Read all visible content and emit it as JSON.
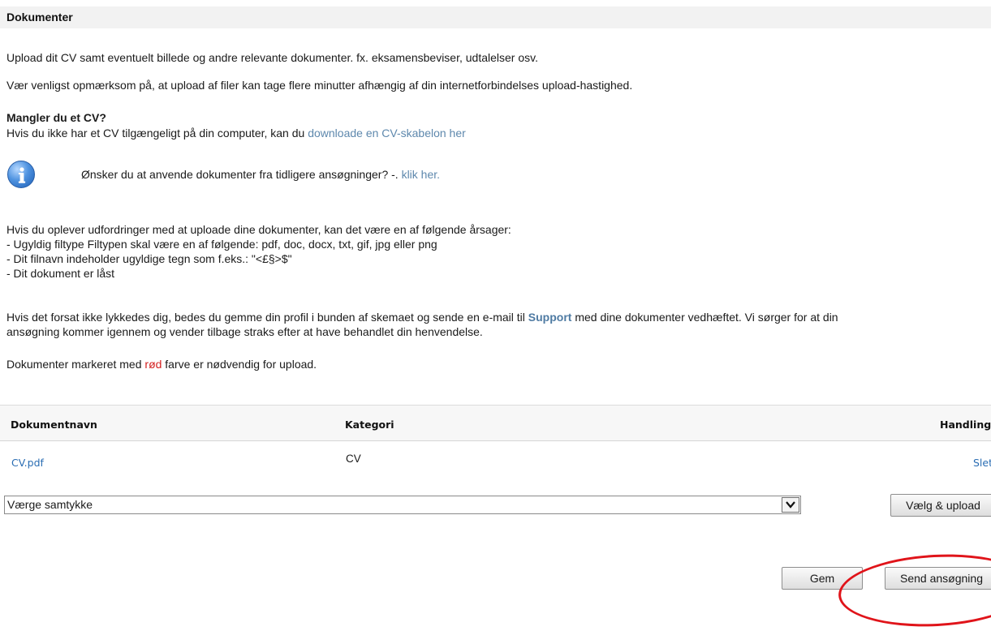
{
  "header": {
    "title": "Dokumenter"
  },
  "intro": {
    "line1": "Upload dit CV samt eventuelt billede og andre relevante dokumenter. fx. eksamensbeviser, udtalelser osv.",
    "line2": "Vær venligst opmærksom på, at upload af filer kan tage flere minutter afhængig af din internetforbindelses upload-hastighed."
  },
  "cv_missing": {
    "heading": "Mangler du et CV?",
    "text": "Hvis du ikke har et CV tilgængeligt på din computer, kan du ",
    "link": "downloade en CV-skabelon her"
  },
  "info": {
    "text": "Ønsker du at anvende dokumenter fra tidligere ansøgninger? -. ",
    "link": "klik her."
  },
  "problems": {
    "intro": "Hvis du oplever udfordringer med at uploade dine dokumenter, kan det være en af følgende årsager:",
    "items": [
      "- Ugyldig filtype Filtypen skal være en af følgende: pdf, doc, docx, txt, gif, jpg eller png",
      "- Dit filnavn indeholder ugyldige tegn som f.eks.: \"<£§>$\"",
      "- Dit dokument er låst"
    ]
  },
  "support": {
    "before": "Hvis det forsat ikke lykkedes dig, bedes du gemme din profil i bunden af skemaet og sende en e-mail til ",
    "link": "Support",
    "after": " med dine dokumenter vedhæftet. Vi sørger for at din",
    "line2": "ansøgning kommer igennem og vender tilbage straks efter at have behandlet din henvendelse."
  },
  "required_note": {
    "before": "Dokumenter markeret med ",
    "red": "rød",
    "after": " farve er nødvendig for upload."
  },
  "table": {
    "columns": [
      "Dokumentnavn",
      "Kategori",
      "Handling"
    ],
    "rows": [
      {
        "name": "CV.pdf",
        "category": "CV",
        "action": "Slet"
      }
    ]
  },
  "upload": {
    "selected_category": "Værge samtykke",
    "upload_button": "Vælg & upload"
  },
  "actions": {
    "save": "Gem",
    "submit": "Send ansøgning"
  },
  "colors": {
    "link": "#5e88ad",
    "required": "#d42020",
    "annotation": "#e0141a"
  }
}
